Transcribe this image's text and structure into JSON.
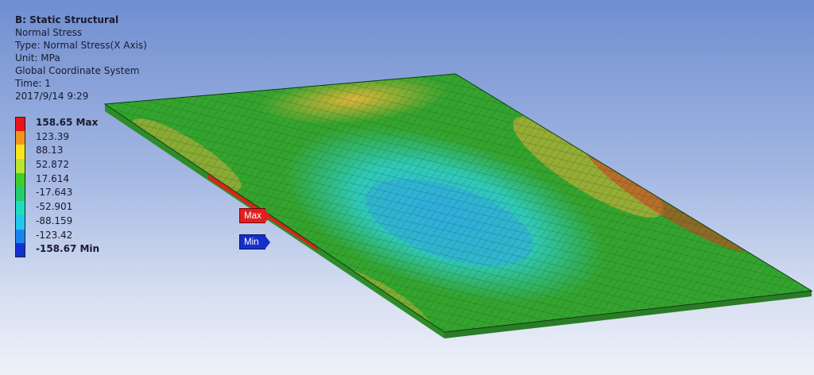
{
  "header": {
    "title": "B: Static Structural",
    "lines": [
      "Normal Stress",
      "Type: Normal Stress(X Axis)",
      "Unit: MPa",
      "Global Coordinate System",
      "Time: 1",
      "2017/9/14 9:29"
    ]
  },
  "legend": {
    "entries": [
      {
        "label": "158.65 Max",
        "color": "#e8141a",
        "bold": true
      },
      {
        "label": "123.39",
        "color": "#f3951f",
        "bold": false
      },
      {
        "label": "88.13",
        "color": "#f7e51b",
        "bold": false
      },
      {
        "label": "52.872",
        "color": "#b8e635",
        "bold": false
      },
      {
        "label": "17.614",
        "color": "#3fcf2c",
        "bold": false
      },
      {
        "label": "-17.643",
        "color": "#23ce6f",
        "bold": false
      },
      {
        "label": "-52.901",
        "color": "#1fdcc0",
        "bold": false
      },
      {
        "label": "-88.159",
        "color": "#22c6ef",
        "bold": false
      },
      {
        "label": "-123.42",
        "color": "#1a84ec",
        "bold": false
      },
      {
        "label": "-158.67 Min",
        "color": "#1230d0",
        "bold": true
      }
    ]
  },
  "probes": {
    "max_label": "Max",
    "min_label": "Min"
  },
  "colors": {
    "plate_base": "#2f9a2c",
    "edge_red": "#d22a1c",
    "center_blue": "#35b6d8",
    "background_top": "#6f8ed0",
    "background_bottom": "#eef1f8"
  }
}
